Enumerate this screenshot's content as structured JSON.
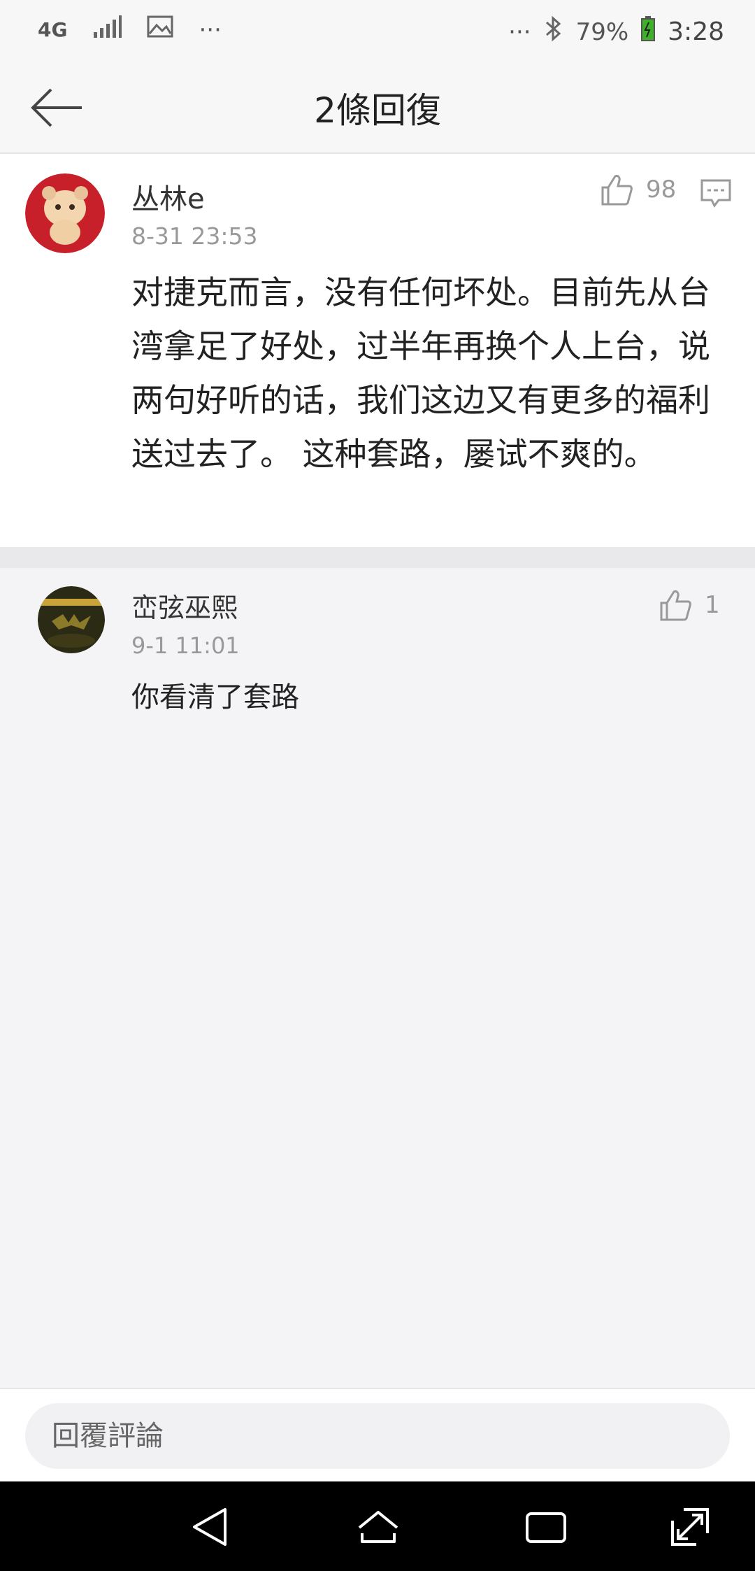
{
  "status_bar": {
    "network": "4G",
    "overflow_left": "···",
    "overflow_right": "···",
    "battery_percent": "79%",
    "time": "3:28"
  },
  "header": {
    "title": "2條回復"
  },
  "main_comment": {
    "username": "丛林e",
    "timestamp": "8-31 23:53",
    "likes": "98",
    "text": "对捷克而言，没有任何坏处。目前先从台湾拿足了好处，过半年再换个人上台，说两句好听的话，我们这边又有更多的福利送过去了。 这种套路，屡试不爽的。"
  },
  "reply": {
    "username": "峦弦巫熙",
    "timestamp": "9-1 11:01",
    "likes": "1",
    "text": "你看清了套路"
  },
  "input": {
    "placeholder": "回覆評論"
  },
  "colors": {
    "background": "#f5f5f7",
    "text_primary": "#222222",
    "text_secondary": "#999999",
    "battery_green": "#3fb02a",
    "nav_bar": "#000000"
  },
  "icons": {
    "back": "arrow-left-icon",
    "like": "thumbs-up-icon",
    "reply": "comment-icon",
    "nav_back": "triangle-back-icon",
    "nav_home": "home-icon",
    "nav_recents": "recents-icon",
    "nav_expand": "expand-icon"
  }
}
